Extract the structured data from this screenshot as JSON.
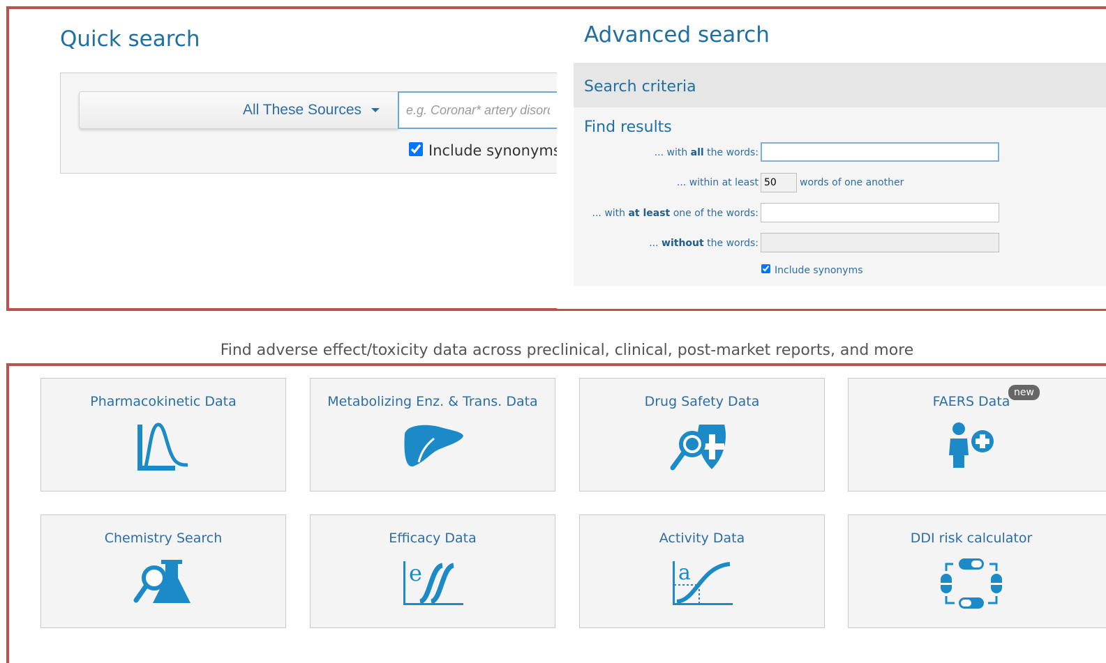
{
  "quick_search": {
    "title": "Quick search",
    "source_dropdown": "All These Sources",
    "search_placeholder": "e.g. Coronar* artery disorder",
    "include_synonyms_label": "Include synonyms",
    "include_synonyms_checked": true
  },
  "advanced_search": {
    "title": "Advanced search",
    "criteria_header": "Search criteria",
    "find_results_header": "Find results",
    "all_words": {
      "prefix": "... with ",
      "bold": "all",
      "suffix": " the words:",
      "value": ""
    },
    "within": {
      "label": "... within at least",
      "value": "50",
      "suffix": "words of one another"
    },
    "at_least_one": {
      "prefix": "... with ",
      "bold": "at least",
      "suffix": " one of the words:",
      "value": ""
    },
    "without": {
      "prefix": "... ",
      "bold": "without",
      "suffix": " the words:",
      "value": ""
    },
    "include_synonyms_label": "Include synonyms",
    "include_synonyms_checked": true
  },
  "tagline": "Find adverse effect/toxicity data across preclinical, clinical, post-market reports, and more",
  "tiles": [
    {
      "label": "Pharmacokinetic Data",
      "icon": "pk-curve-icon"
    },
    {
      "label": "Metabolizing Enz. & Trans. Data",
      "icon": "liver-icon"
    },
    {
      "label": "Drug Safety Data",
      "icon": "safety-magnifier-shield-icon"
    },
    {
      "label": "FAERS Data",
      "icon": "person-pill-icon",
      "badge": "new"
    },
    {
      "label": "Chemistry Search",
      "icon": "flask-magnifier-icon"
    },
    {
      "label": "Efficacy Data",
      "icon": "efficacy-curve-icon"
    },
    {
      "label": "Activity Data",
      "icon": "activity-curve-icon"
    },
    {
      "label": "DDI risk calculator",
      "icon": "pill-cycle-icon"
    }
  ],
  "colors": {
    "accent": "#1f6fa3",
    "icon_blue": "#1d8ac8",
    "frame_red": "#c0504d"
  }
}
